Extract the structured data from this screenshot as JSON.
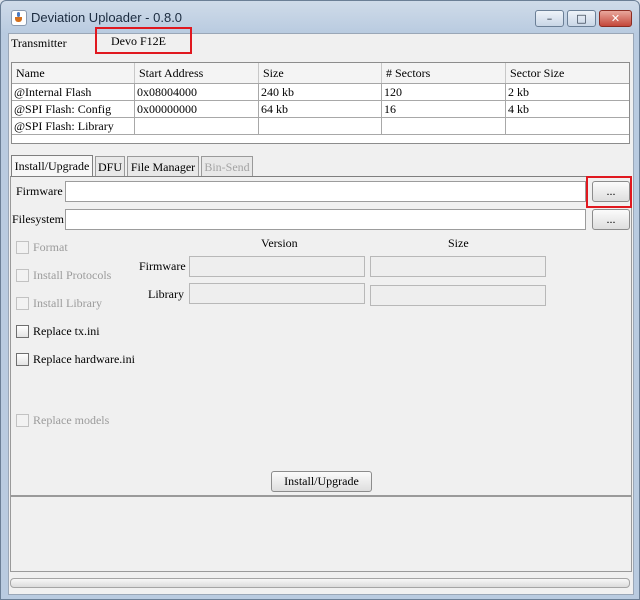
{
  "window": {
    "title": "Deviation Uploader - 0.8.0",
    "controls": {
      "minimize": "–",
      "maximize": "□",
      "close": "✕"
    }
  },
  "transmitter": {
    "label": "Transmitter",
    "value": "Devo F12E"
  },
  "memory_table": {
    "columns": [
      "Name",
      "Start Address",
      "Size",
      "# Sectors",
      "Sector Size"
    ],
    "rows": [
      [
        "@Internal Flash",
        "0x08004000",
        "240 kb",
        "120",
        "2 kb"
      ],
      [
        "@SPI Flash: Config",
        "0x00000000",
        "64 kb",
        "16",
        "4 kb"
      ],
      [
        "@SPI Flash: Library",
        "",
        "",
        "",
        ""
      ]
    ]
  },
  "tabs": [
    {
      "label": "Install/Upgrade",
      "state": "active"
    },
    {
      "label": "DFU",
      "state": "normal"
    },
    {
      "label": "File Manager",
      "state": "normal"
    },
    {
      "label": "Bin-Send",
      "state": "disabled"
    }
  ],
  "install": {
    "firmware_label": "Firmware",
    "firmware_value": "",
    "filesystem_label": "Filesystem",
    "filesystem_value": "",
    "browse_label": "...",
    "version_header": "Version",
    "size_header": "Size",
    "version_rows": [
      {
        "label": "Firmware",
        "version": "",
        "size": ""
      },
      {
        "label": "Library",
        "version": "",
        "size": ""
      }
    ],
    "options": [
      {
        "label": "Format",
        "enabled": false,
        "checked": false
      },
      {
        "label": "Install Protocols",
        "enabled": false,
        "checked": false
      },
      {
        "label": "Install Library",
        "enabled": false,
        "checked": false
      },
      {
        "label": "Replace tx.ini",
        "enabled": true,
        "checked": false
      },
      {
        "label": "Replace hardware.ini",
        "enabled": true,
        "checked": false
      },
      {
        "label": "Replace models",
        "enabled": false,
        "checked": false
      }
    ],
    "action_button": "Install/Upgrade"
  },
  "status_text": "",
  "progress": 0
}
